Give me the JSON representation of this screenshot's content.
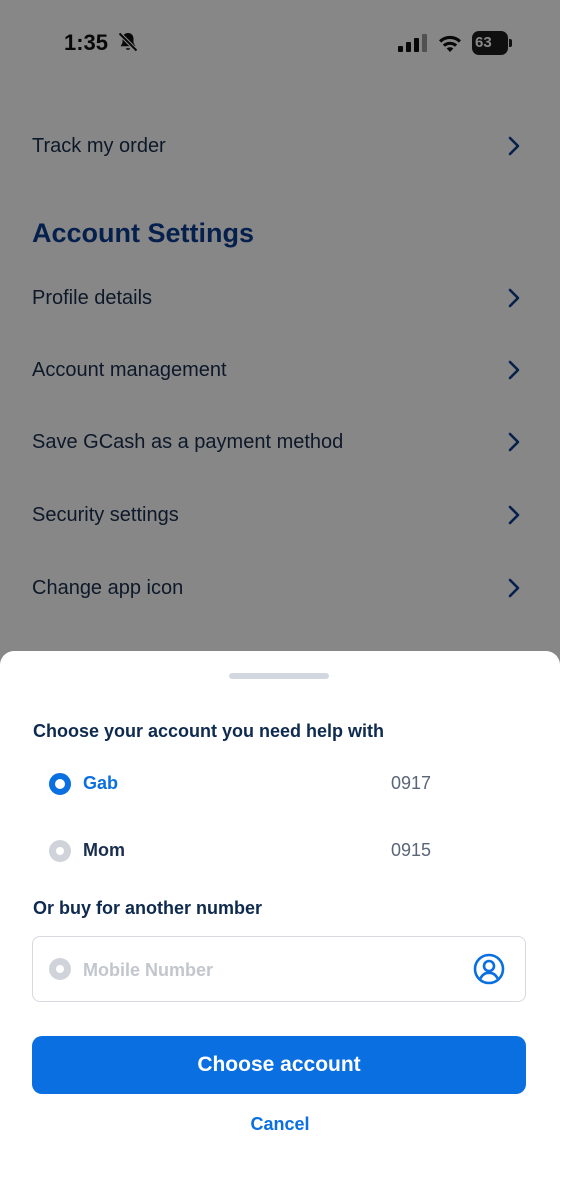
{
  "status_bar": {
    "time": "1:35",
    "battery": "63"
  },
  "menu": {
    "track_order": "Track my order",
    "section_title": "Account Settings",
    "items": [
      {
        "label": "Profile details"
      },
      {
        "label": "Account management"
      },
      {
        "label": "Save GCash as a payment method"
      },
      {
        "label": "Security settings"
      },
      {
        "label": "Change app icon"
      }
    ]
  },
  "sheet": {
    "heading": "Choose your account you need help with",
    "accounts": [
      {
        "name": "Gab",
        "number": "0917",
        "selected": true
      },
      {
        "name": "Mom",
        "number": "0915",
        "selected": false
      }
    ],
    "other_heading": "Or buy for another number",
    "number_field": {
      "placeholder": "Mobile Number",
      "value": ""
    },
    "primary_button": "Choose account",
    "cancel": "Cancel"
  },
  "colors": {
    "accent": "#0a6fe0",
    "heading": "#0e2a4e",
    "section_title": "#0b3d91",
    "overlay": "rgba(0,0,0,0.47)"
  },
  "icons": [
    "bell-slash-icon",
    "signal-icon",
    "wifi-icon",
    "battery-icon",
    "chevron-right-icon",
    "contact-icon"
  ]
}
